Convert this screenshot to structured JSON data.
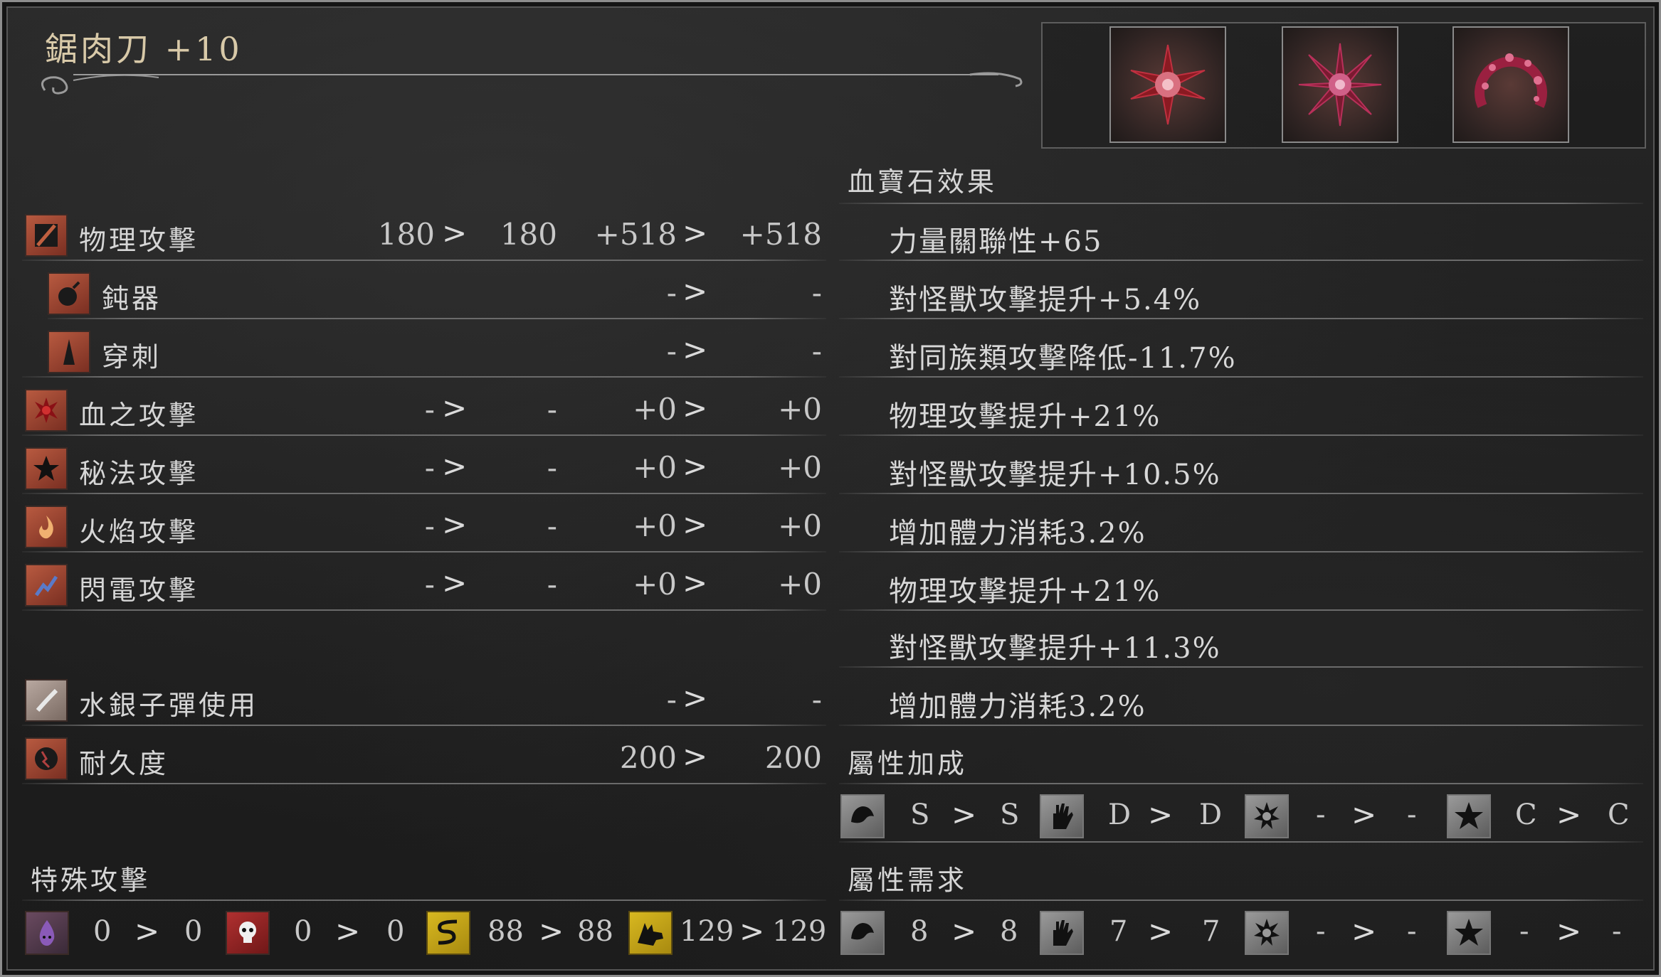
{
  "weapon": {
    "name": "鋸肉刀 +10"
  },
  "gems": [
    "blood-gem-radial-icon",
    "blood-gem-radial-icon",
    "blood-gem-waning-icon"
  ],
  "attack_rows": [
    {
      "label": "物理攻擊",
      "icon": "physical-attack-icon",
      "base_from": "180",
      "base_to": "180",
      "bonus_from": "+518",
      "bonus_to": "+518"
    },
    {
      "label": "鈍器",
      "icon": "blunt-icon",
      "base_from": "",
      "base_to": "",
      "bonus_from": "-",
      "bonus_to": "-"
    },
    {
      "label": "穿刺",
      "icon": "thrust-icon",
      "base_from": "",
      "base_to": "",
      "bonus_from": "-",
      "bonus_to": "-"
    },
    {
      "label": "血之攻擊",
      "icon": "blood-attack-icon",
      "base_from": "-",
      "base_to": "-",
      "bonus_from": "+0",
      "bonus_to": "+0"
    },
    {
      "label": "秘法攻擊",
      "icon": "arcane-attack-icon",
      "base_from": "-",
      "base_to": "-",
      "bonus_from": "+0",
      "bonus_to": "+0"
    },
    {
      "label": "火焰攻擊",
      "icon": "fire-attack-icon",
      "base_from": "-",
      "base_to": "-",
      "bonus_from": "+0",
      "bonus_to": "+0"
    },
    {
      "label": "閃電攻擊",
      "icon": "bolt-attack-icon",
      "base_from": "-",
      "base_to": "-",
      "bonus_from": "+0",
      "bonus_to": "+0"
    }
  ],
  "quicksilver": {
    "label": "水銀子彈使用",
    "from": "-",
    "to": "-"
  },
  "durability": {
    "label": "耐久度",
    "from": "200",
    "to": "200"
  },
  "arrow": ">",
  "gem_effects": {
    "title": "血寶石效果",
    "items": [
      "力量關聯性+65",
      "對怪獸攻擊提升+5.4%",
      "對同族類攻擊降低-11.7%",
      "物理攻擊提升+21%",
      "對怪獸攻擊提升+10.5%",
      "增加體力消耗3.2%",
      "物理攻擊提升+21%",
      "對怪獸攻擊提升+11.3%",
      "增加體力消耗3.2%"
    ]
  },
  "scaling": {
    "title": "屬性加成",
    "items": [
      {
        "icon": "strength-icon",
        "from": "S",
        "to": "S"
      },
      {
        "icon": "skill-icon",
        "from": "D",
        "to": "D"
      },
      {
        "icon": "bloodtinge-icon",
        "from": "-",
        "to": "-"
      },
      {
        "icon": "arcane-icon",
        "from": "C",
        "to": "C"
      }
    ]
  },
  "requirements": {
    "title": "屬性需求",
    "items": [
      {
        "icon": "strength-icon",
        "from": "8",
        "to": "8"
      },
      {
        "icon": "skill-icon",
        "from": "7",
        "to": "7"
      },
      {
        "icon": "bloodtinge-icon",
        "from": "-",
        "to": "-"
      },
      {
        "icon": "arcane-icon",
        "from": "-",
        "to": "-"
      }
    ]
  },
  "special": {
    "title": "特殊攻擊",
    "items": [
      {
        "icon": "kin-icon",
        "from": "0",
        "to": "0"
      },
      {
        "icon": "skull-icon",
        "from": "0",
        "to": "0"
      },
      {
        "icon": "serpent-icon",
        "from": "88",
        "to": "88"
      },
      {
        "icon": "beast-icon",
        "from": "129",
        "to": "129"
      }
    ]
  },
  "colors": {
    "title": "#d8c9a8",
    "icon_red": "#9e4530",
    "gold": "#c8a517",
    "line": "#6b6b6b"
  }
}
